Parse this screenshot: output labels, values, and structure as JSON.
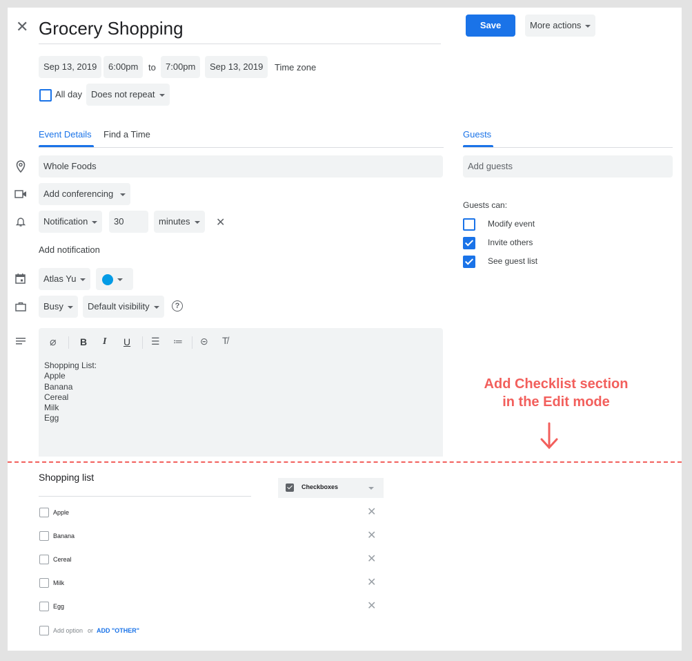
{
  "header": {
    "title": "Grocery Shopping",
    "save_label": "Save",
    "more_actions_label": "More actions"
  },
  "datetime": {
    "start_date": "Sep 13, 2019",
    "start_time": "6:00pm",
    "to_label": "to",
    "end_time": "7:00pm",
    "end_date": "Sep 13, 2019",
    "timezone_label": "Time zone",
    "all_day_label": "All day",
    "all_day_checked": false,
    "repeat_value": "Does not repeat"
  },
  "tabs": {
    "event_details": "Event Details",
    "find_a_time": "Find a Time",
    "guests": "Guests"
  },
  "details": {
    "location": "Whole Foods",
    "conferencing": "Add conferencing",
    "notification_type": "Notification",
    "notification_value": "30",
    "notification_unit": "minutes",
    "add_notification": "Add notification",
    "calendar_owner": "Atlas Yu",
    "calendar_color": "#039be5",
    "availability": "Busy",
    "visibility": "Default visibility",
    "description_lines": [
      "Shopping List:",
      "Apple",
      "Banana",
      "Cereal",
      "Milk",
      "Egg"
    ]
  },
  "guests": {
    "add_placeholder": "Add guests",
    "guests_can_label": "Guests can:",
    "permissions": [
      {
        "label": "Modify event",
        "checked": false
      },
      {
        "label": "Invite others",
        "checked": true
      },
      {
        "label": "See guest list",
        "checked": true
      }
    ]
  },
  "annotation": {
    "line1": "Add Checklist section",
    "line2": "in the Edit mode",
    "color": "#f25f5c"
  },
  "checklist": {
    "title": "Shopping list",
    "type_label": "Checkboxes",
    "items": [
      "Apple",
      "Banana",
      "Cereal",
      "Milk",
      "Egg"
    ],
    "add_option": "Add option",
    "or_label": "or",
    "add_other": "ADD \"OTHER\""
  },
  "colors": {
    "accent": "#1a73e8",
    "chip_bg": "#f1f3f4"
  }
}
